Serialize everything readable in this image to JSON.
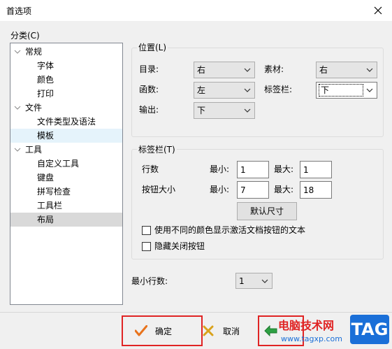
{
  "window": {
    "title": "首选项"
  },
  "category": {
    "label": "分类(C)",
    "items": [
      {
        "label": "常规",
        "level": 0,
        "caret": true
      },
      {
        "label": "字体",
        "level": 1
      },
      {
        "label": "颜色",
        "level": 1
      },
      {
        "label": "打印",
        "level": 1
      },
      {
        "label": "文件",
        "level": 0,
        "caret": true
      },
      {
        "label": "文件类型及语法",
        "level": 1
      },
      {
        "label": "模板",
        "level": 1,
        "state": "hover"
      },
      {
        "label": "工具",
        "level": 0,
        "caret": true
      },
      {
        "label": "自定义工具",
        "level": 1
      },
      {
        "label": "键盘",
        "level": 1
      },
      {
        "label": "拼写检查",
        "level": 1
      },
      {
        "label": "工具栏",
        "level": 1
      },
      {
        "label": "布局",
        "level": 1,
        "state": "selected"
      }
    ]
  },
  "position": {
    "label": "位置(L)",
    "directory_label": "目录:",
    "directory_value": "右",
    "material_label": "素材:",
    "material_value": "右",
    "function_label": "函数:",
    "function_value": "左",
    "tabbar_label": "标签栏:",
    "tabbar_value": "下",
    "output_label": "输出:",
    "output_value": "下"
  },
  "tabbar": {
    "label": "标签栏(T)",
    "rows_label": "行数",
    "button_size_label": "按钮大小",
    "min_label": "最小:",
    "max_label": "最大:",
    "rows_min": "1",
    "rows_max": "1",
    "size_min": "7",
    "size_max": "18",
    "default_size_button": "默认尺寸",
    "color_checkbox_label": "使用不同的颜色显示激活文档按钮的文本",
    "color_checkbox_checked": false,
    "hide_close_label": "隐藏关闭按钮",
    "hide_close_checked": false
  },
  "min_rows": {
    "label": "最小行数:",
    "value": "1"
  },
  "footer": {
    "ok": "确定",
    "cancel": "取消",
    "watermark_text": "电脑技术网",
    "watermark_url": "www.tagxp.com",
    "watermark_badge": "TAG"
  },
  "colors": {
    "accent_red": "#e02424",
    "ok_check": "#e8731c",
    "cancel_x": "#d9a21b",
    "tag_blue": "#1a6fd8"
  }
}
